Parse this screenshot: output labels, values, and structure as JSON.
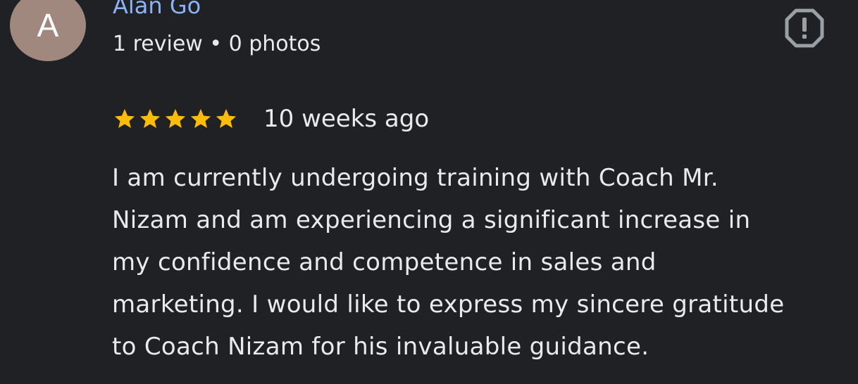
{
  "reviewer": {
    "avatar_letter": "A",
    "avatar_color": "#a1887f",
    "name": "Alan Go",
    "name_color": "#8ab4f8",
    "meta": "1 review • 0 photos"
  },
  "report": {
    "icon": "report-flag-icon"
  },
  "review": {
    "rating": 5,
    "rating_max": 5,
    "star_color": "#fbbc04",
    "date": "10 weeks ago",
    "lines": [
      "I am currently undergoing training with Coach Mr.",
      "Nizam and am experiencing a significant increase in",
      "my confidence and competence in sales and",
      "marketing. I would like to express my sincere gratitude",
      "to Coach Nizam for his invaluable guidance."
    ]
  }
}
